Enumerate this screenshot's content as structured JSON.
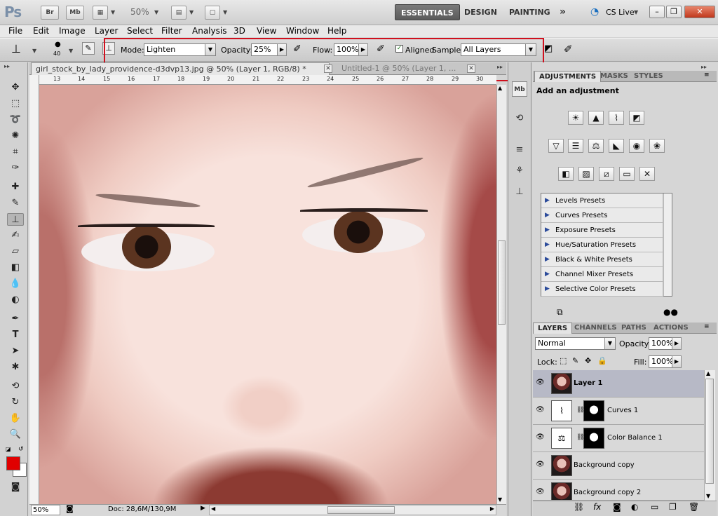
{
  "app": {
    "logo": "Ps",
    "bridge": "Br",
    "minibridge": "Mb",
    "zoom": "50%"
  },
  "workspaces": [
    "ESSENTIALS",
    "DESIGN",
    "PAINTING"
  ],
  "more": "»",
  "cslive": "CS Live",
  "menu": [
    "File",
    "Edit",
    "Image",
    "Layer",
    "Select",
    "Filter",
    "Analysis",
    "3D",
    "View",
    "Window",
    "Help"
  ],
  "options": {
    "brush_size": "40",
    "mode_label": "Mode:",
    "mode": "Lighten",
    "opacity_label": "Opacity:",
    "opacity": "25%",
    "flow_label": "Flow:",
    "flow": "100%",
    "aligned": "Aligned",
    "sample_label": "Sample:",
    "sample": "All Layers"
  },
  "tabs": [
    {
      "title": "girl_stock_by_lady_providence-d3dvp13.jpg @ 50% (Layer 1, RGB/8) *"
    },
    {
      "title": "Untitled-1 @ 50% (Layer 1, ..."
    }
  ],
  "ruler": [
    "13",
    "14",
    "15",
    "16",
    "17",
    "18",
    "19",
    "20",
    "21",
    "22",
    "23",
    "24",
    "25",
    "26",
    "27",
    "28",
    "29",
    "30"
  ],
  "status": {
    "zoom": "50%",
    "doc": "Doc: 28,6M/130,9M"
  },
  "adjustments": {
    "tabs": [
      "ADJUSTMENTS",
      "MASKS",
      "STYLES"
    ],
    "heading": "Add an adjustment",
    "presets": [
      "Levels Presets",
      "Curves Presets",
      "Exposure Presets",
      "Hue/Saturation Presets",
      "Black & White Presets",
      "Channel Mixer Presets",
      "Selective Color Presets"
    ]
  },
  "layers": {
    "tabs": [
      "LAYERS",
      "CHANNELS",
      "PATHS",
      "ACTIONS"
    ],
    "blend": "Normal",
    "opacity_label": "Opacity:",
    "opacity": "100%",
    "lock_label": "Lock:",
    "fill_label": "Fill:",
    "fill": "100%",
    "items": [
      {
        "name": "Layer 1"
      },
      {
        "name": "Curves 1"
      },
      {
        "name": "Color Balance 1"
      },
      {
        "name": "Background copy"
      },
      {
        "name": "Background copy 2"
      }
    ]
  },
  "colors": {
    "foreground": "#e00000",
    "background": "#ffffff",
    "highlight": "#d0101e"
  }
}
